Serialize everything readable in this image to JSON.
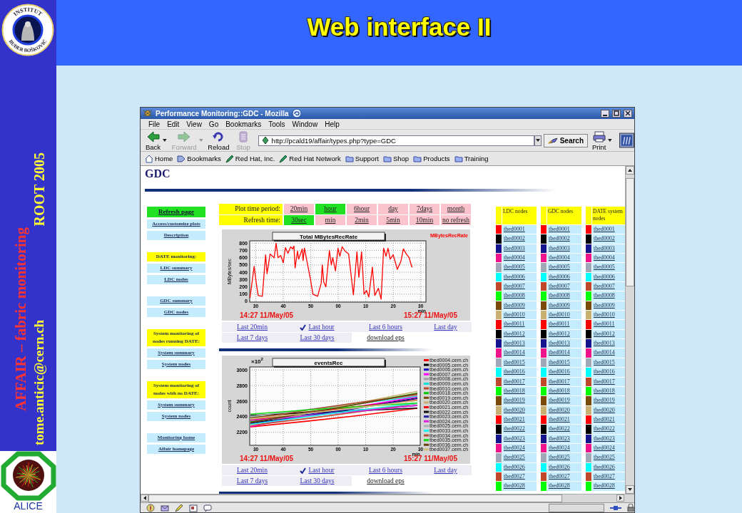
{
  "slide": {
    "title": "Web interface II",
    "sidebar": {
      "logo_top": "INSTITUT",
      "logo_bottom": "RUĐER BOŠKOVIĆ",
      "project": "AFFAIR – fabric monitoring",
      "event": "ROOT 2005",
      "email": "tome.anticic@cern.ch",
      "bottom_logo": "ALICE"
    }
  },
  "browser": {
    "title": "Performance Monitoring::GDC - Mozilla",
    "menu": [
      "File",
      "Edit",
      "View",
      "Go",
      "Bookmarks",
      "Tools",
      "Window",
      "Help"
    ],
    "toolbar": [
      {
        "label": "Back",
        "kind": "back",
        "disabled": false,
        "has_menu": true
      },
      {
        "label": "Forward",
        "kind": "forward",
        "disabled": true,
        "has_menu": true
      },
      {
        "label": "Reload",
        "kind": "reload",
        "disabled": false,
        "has_menu": false
      },
      {
        "label": "Stop",
        "kind": "stop",
        "disabled": true,
        "has_menu": false
      }
    ],
    "address": {
      "value": "http://pcald19/affair/types.php?type=GDC"
    },
    "search_button": "Search",
    "toolbar_end": [
      {
        "label": "Print",
        "kind": "print",
        "disabled": false,
        "has_menu": true
      }
    ],
    "bookmarks": [
      {
        "label": "Home",
        "kind": "home"
      },
      {
        "label": "Bookmarks",
        "kind": "bookmarks"
      },
      {
        "label": "Red Hat, Inc.",
        "kind": "link"
      },
      {
        "label": "Red Hat Network",
        "kind": "link"
      },
      {
        "label": "Support",
        "kind": "folder"
      },
      {
        "label": "Shop",
        "kind": "folder"
      },
      {
        "label": "Products",
        "kind": "folder"
      },
      {
        "label": "Training",
        "kind": "folder"
      }
    ]
  },
  "page": {
    "heading": "GDC",
    "nav_groups": [
      {
        "items": [
          {
            "label": "Refresh page",
            "kind": "button"
          },
          {
            "label": "Access/customize plots",
            "kind": "link"
          },
          {
            "label": "Description",
            "kind": "link"
          }
        ]
      },
      {
        "items": [
          {
            "label": "DATE monitoring:",
            "kind": "heading"
          },
          {
            "label": "LDC summary",
            "kind": "link"
          },
          {
            "label": "LDC nodes",
            "kind": "link"
          }
        ]
      },
      {
        "items": [
          {
            "label": "GDC summary",
            "kind": "link"
          },
          {
            "label": "GDC nodes",
            "kind": "link"
          }
        ]
      },
      {
        "items": [
          {
            "label": "System monitoring of nodes running DATE:",
            "kind": "heading"
          },
          {
            "label": "System summary",
            "kind": "link"
          },
          {
            "label": "System nodes",
            "kind": "link"
          }
        ]
      },
      {
        "items": [
          {
            "label": "System monitoring of nodes with no DATE:",
            "kind": "heading"
          },
          {
            "label": "System summary",
            "kind": "link"
          },
          {
            "label": "System nodes",
            "kind": "link"
          }
        ]
      },
      {
        "items": [
          {
            "label": "Monitoring home",
            "kind": "link"
          },
          {
            "label": "Affair homepage",
            "kind": "link"
          }
        ]
      }
    ],
    "controls": [
      {
        "label": "Plot time period:",
        "options": [
          {
            "label": "20min",
            "selected": false
          },
          {
            "label": "hour",
            "selected": true
          },
          {
            "label": "6hour",
            "selected": false
          },
          {
            "label": "day",
            "selected": false
          },
          {
            "label": "7days",
            "selected": false
          },
          {
            "label": "month",
            "selected": false
          }
        ]
      },
      {
        "label": "Refresh time:",
        "options": [
          {
            "label": "30sec",
            "selected": true
          },
          {
            "label": "min",
            "selected": false
          },
          {
            "label": "2min",
            "selected": false
          },
          {
            "label": "5min",
            "selected": false
          },
          {
            "label": "10min",
            "selected": false
          },
          {
            "label": "no refresh",
            "selected": false
          }
        ]
      }
    ],
    "plots": [
      {
        "start_time": "14:27 11/May/05",
        "end_time": "15:27 11/May/05",
        "next_hour_tick_labels": [
          "00",
          "10",
          "20",
          "30"
        ],
        "chart_data": {
          "type": "line",
          "title": "Total  MBytesRecRate",
          "xlabel": "min",
          "ylabel": "MBytes/sec",
          "x": [
            27.9,
            29.4,
            30.2,
            30.9,
            32.4,
            33.6,
            34.1,
            35.2,
            36.7,
            37.4,
            38.1,
            39.1,
            40.0,
            40.8,
            41.7,
            42.7,
            43.4,
            43.9,
            44.3,
            45.2,
            45.6,
            46.9,
            47.2,
            47.7,
            48.6,
            49.9,
            50.8,
            52.5,
            53.8,
            54.2,
            54.7,
            55.5,
            56.8,
            57.5,
            58.0,
            59.0,
            59.9,
            60.6,
            61.4,
            62.5,
            63.8,
            65.5,
            66.8,
            67.5,
            68.5,
            69.4,
            70.3,
            71.1,
            72.4,
            73.3,
            74.6,
            75.6,
            76.5,
            77.4,
            78.1,
            78.9,
            80.0,
            81.5,
            82.8,
            83.7,
            84.8,
            85.8,
            86.7,
            87.0
          ],
          "series": [
            {
              "name": "MBytesRecRate",
              "color": "#ff0000",
              "values": [
                50,
                480,
                250,
                80,
                70,
                640,
                380,
                650,
                600,
                800,
                600,
                630,
                530,
                740,
                660,
                750,
                720,
                760,
                460,
                690,
                580,
                720,
                560,
                730,
                560,
                300,
                100,
                70,
                250,
                500,
                270,
                200,
                700,
                500,
                600,
                420,
                730,
                620,
                750,
                690,
                650,
                90,
                680,
                330,
                680,
                100,
                150,
                60,
                470,
                80,
                180,
                30,
                730,
                620,
                730,
                580,
                640,
                440,
                550,
                720,
                650,
                600,
                480,
                470
              ]
            }
          ],
          "xlim": [
            27.8,
            91.9
          ],
          "ylim": [
            -10,
            832
          ],
          "xticks": [
            30,
            40,
            50
          ],
          "yticks": [
            0,
            100,
            200,
            300,
            400,
            500,
            600,
            700,
            800
          ],
          "grid": true
        },
        "range_links": [
          {
            "links": [
              {
                "label": "Last 20min",
                "kind": "link",
                "selected": false
              },
              {
                "label": "Last hour",
                "kind": "link",
                "selected": true
              },
              {
                "label": "Last 6 hours",
                "kind": "link",
                "selected": false
              },
              {
                "label": "Last day",
                "kind": "link",
                "selected": false
              }
            ]
          },
          {
            "links": [
              {
                "label": "Last 7 days",
                "kind": "link",
                "selected": false
              },
              {
                "label": "Last 30 days",
                "kind": "link",
                "selected": false
              },
              {
                "label": "download eps",
                "kind": "download",
                "selected": false
              }
            ]
          }
        ]
      },
      {
        "start_time": "14:27 11/May/05",
        "end_time": "15:27 11/May/05",
        "y_multiplier": "×10$^{2}$",
        "title": "eventsRec",
        "xlabel": "min",
        "ylabel": "count",
        "xticks": [
          "30",
          "40",
          "50",
          "00",
          "10",
          "20",
          "30"
        ],
        "yticks": [
          "3000",
          "2800",
          "2600",
          "2400",
          "2200"
        ],
        "legend": [
          {
            "name": "tbed0004.cern.ch",
            "color": "#ff0000"
          },
          {
            "name": "tbed0005.cern.ch",
            "color": "#000000"
          },
          {
            "name": "tbed0006.cern.ch",
            "color": "#1010c0"
          },
          {
            "name": "tbed0007.cern.ch",
            "color": "#ff00ff"
          },
          {
            "name": "tbed0008.cern.ch",
            "color": "#a0a0a8"
          },
          {
            "name": "tbed0009.cern.ch",
            "color": "#00e0e0"
          },
          {
            "name": "tbed0010.cern.ch",
            "color": "#c0482a"
          },
          {
            "name": "tbed0018.cern.ch",
            "color": "#00cc00"
          },
          {
            "name": "tbed0019.cern.ch",
            "color": "#7a4a0a"
          },
          {
            "name": "tbed0020.cern.ch",
            "color": "#c8b070"
          },
          {
            "name": "tbed0021.cern.ch",
            "color": "#ee1010"
          },
          {
            "name": "tbed0022.cern.ch",
            "color": "#101010"
          },
          {
            "name": "tbed0023.cern.ch",
            "color": "#2020a0"
          },
          {
            "name": "tbed0024.cern.ch",
            "color": "#e020e0"
          },
          {
            "name": "tbed0025.cern.ch",
            "color": "#b0b0b8"
          },
          {
            "name": "tbed0033.cern.ch",
            "color": "#20f0f0"
          },
          {
            "name": "tbed0034.cern.ch",
            "color": "#b05030"
          },
          {
            "name": "tbed0035.cern.ch",
            "color": "#10dd10"
          },
          {
            "name": "tbed0036.cern.ch",
            "color": "#6a4010"
          },
          {
            "name": "tbed0037.cern.ch",
            "color": "#d0c080"
          }
        ],
        "range_links": [
          {
            "links": [
              {
                "label": "Last 20min",
                "kind": "link",
                "selected": false
              },
              {
                "label": "Last hour",
                "kind": "link",
                "selected": true
              },
              {
                "label": "Last 6 hours",
                "kind": "link",
                "selected": false
              },
              {
                "label": "Last day",
                "kind": "link",
                "selected": false
              }
            ]
          },
          {
            "links": [
              {
                "label": "Last 7 days",
                "kind": "link",
                "selected": false
              },
              {
                "label": "Last 30 days",
                "kind": "link",
                "selected": false
              },
              {
                "label": "download eps",
                "kind": "download",
                "selected": false
              }
            ]
          }
        ]
      }
    ],
    "node_columns": [
      {
        "header": "LDC nodes",
        "nodes": [
          {
            "name": "tbed0001",
            "color": "#ff0000"
          },
          {
            "name": "tbed0002",
            "color": "#000000"
          },
          {
            "name": "tbed0003",
            "color": "#14148c"
          },
          {
            "name": "tbed0004",
            "color": "#f0148c"
          },
          {
            "name": "tbed0005",
            "color": "#a0a8b8"
          },
          {
            "name": "tbed0006",
            "color": "#00ffff"
          },
          {
            "name": "tbed0007",
            "color": "#c0482a"
          },
          {
            "name": "tbed0008",
            "color": "#00ff00"
          },
          {
            "name": "tbed0009",
            "color": "#7a4a0a"
          },
          {
            "name": "tbed0010",
            "color": "#c8b070"
          },
          {
            "name": "tbed0011",
            "color": "#ff0000"
          },
          {
            "name": "tbed0012",
            "color": "#000000"
          },
          {
            "name": "tbed0013",
            "color": "#14148c"
          },
          {
            "name": "tbed0014",
            "color": "#f0148c"
          },
          {
            "name": "tbed0015",
            "color": "#a0a8b8"
          },
          {
            "name": "tbed0016",
            "color": "#00ffff"
          },
          {
            "name": "tbed0017",
            "color": "#c0482a"
          },
          {
            "name": "tbed0018",
            "color": "#00ff00"
          },
          {
            "name": "tbed0019",
            "color": "#7a4a0a"
          },
          {
            "name": "tbed0020",
            "color": "#c8b070"
          },
          {
            "name": "tbed0021",
            "color": "#ff0000"
          },
          {
            "name": "tbed0022",
            "color": "#000000"
          },
          {
            "name": "tbed0023",
            "color": "#14148c"
          },
          {
            "name": "tbed0024",
            "color": "#f0148c"
          },
          {
            "name": "tbed0025",
            "color": "#a0a8b8"
          },
          {
            "name": "tbed0026",
            "color": "#00ffff"
          },
          {
            "name": "tbed0027",
            "color": "#c0482a"
          },
          {
            "name": "tbed0028",
            "color": "#00ff00"
          }
        ]
      },
      {
        "header": "GDC nodes",
        "nodes": [
          {
            "name": "tbed0001",
            "color": "#ff0000"
          },
          {
            "name": "tbed0002",
            "color": "#000000"
          },
          {
            "name": "tbed0003",
            "color": "#14148c"
          },
          {
            "name": "tbed0004",
            "color": "#f0148c"
          },
          {
            "name": "tbed0005",
            "color": "#a0a8b8"
          },
          {
            "name": "tbed0006",
            "color": "#00ffff"
          },
          {
            "name": "tbed0007",
            "color": "#c0482a"
          },
          {
            "name": "tbed0008",
            "color": "#00ff00"
          },
          {
            "name": "tbed0009",
            "color": "#7a4a0a"
          },
          {
            "name": "tbed0010",
            "color": "#c8b070"
          },
          {
            "name": "tbed0011",
            "color": "#ff0000"
          },
          {
            "name": "tbed0012",
            "color": "#000000"
          },
          {
            "name": "tbed0013",
            "color": "#14148c"
          },
          {
            "name": "tbed0014",
            "color": "#f0148c"
          },
          {
            "name": "tbed0015",
            "color": "#a0a8b8"
          },
          {
            "name": "tbed0016",
            "color": "#00ffff"
          },
          {
            "name": "tbed0017",
            "color": "#c0482a"
          },
          {
            "name": "tbed0018",
            "color": "#00ff00"
          },
          {
            "name": "tbed0019",
            "color": "#7a4a0a"
          },
          {
            "name": "tbed0020",
            "color": "#c8b070"
          },
          {
            "name": "tbed0021",
            "color": "#ff0000"
          },
          {
            "name": "tbed0022",
            "color": "#000000"
          },
          {
            "name": "tbed0023",
            "color": "#14148c"
          },
          {
            "name": "tbed0024",
            "color": "#f0148c"
          },
          {
            "name": "tbed0025",
            "color": "#a0a8b8"
          },
          {
            "name": "tbed0026",
            "color": "#00ffff"
          },
          {
            "name": "tbed0027",
            "color": "#c0482a"
          },
          {
            "name": "tbed0028",
            "color": "#00ff00"
          }
        ]
      },
      {
        "header": "DATE system nodes",
        "nodes": [
          {
            "name": "tbed0001",
            "color": "#ff0000"
          },
          {
            "name": "tbed0002",
            "color": "#000000"
          },
          {
            "name": "tbed0003",
            "color": "#14148c"
          },
          {
            "name": "tbed0004",
            "color": "#f0148c"
          },
          {
            "name": "tbed0005",
            "color": "#a0a8b8"
          },
          {
            "name": "tbed0006",
            "color": "#00ffff"
          },
          {
            "name": "tbed0007",
            "color": "#c0482a"
          },
          {
            "name": "tbed0008",
            "color": "#00ff00"
          },
          {
            "name": "tbed0009",
            "color": "#7a4a0a"
          },
          {
            "name": "tbed0010",
            "color": "#c8b070"
          },
          {
            "name": "tbed0011",
            "color": "#ff0000"
          },
          {
            "name": "tbed0012",
            "color": "#000000"
          },
          {
            "name": "tbed0013",
            "color": "#14148c"
          },
          {
            "name": "tbed0014",
            "color": "#f0148c"
          },
          {
            "name": "tbed0015",
            "color": "#a0a8b8"
          },
          {
            "name": "tbed0016",
            "color": "#00ffff"
          },
          {
            "name": "tbed0017",
            "color": "#c0482a"
          },
          {
            "name": "tbed0018",
            "color": "#00ff00"
          },
          {
            "name": "tbed0019",
            "color": "#7a4a0a"
          },
          {
            "name": "tbed0020",
            "color": "#c8b070"
          },
          {
            "name": "tbed0021",
            "color": "#ff0000"
          },
          {
            "name": "tbed0022",
            "color": "#000000"
          },
          {
            "name": "tbed0023",
            "color": "#14148c"
          },
          {
            "name": "tbed0024",
            "color": "#f0148c"
          },
          {
            "name": "tbed0025",
            "color": "#a0a8b8"
          },
          {
            "name": "tbed0026",
            "color": "#00ffff"
          },
          {
            "name": "tbed0027",
            "color": "#c0482a"
          },
          {
            "name": "tbed0028",
            "color": "#00ff00"
          }
        ]
      }
    ]
  }
}
